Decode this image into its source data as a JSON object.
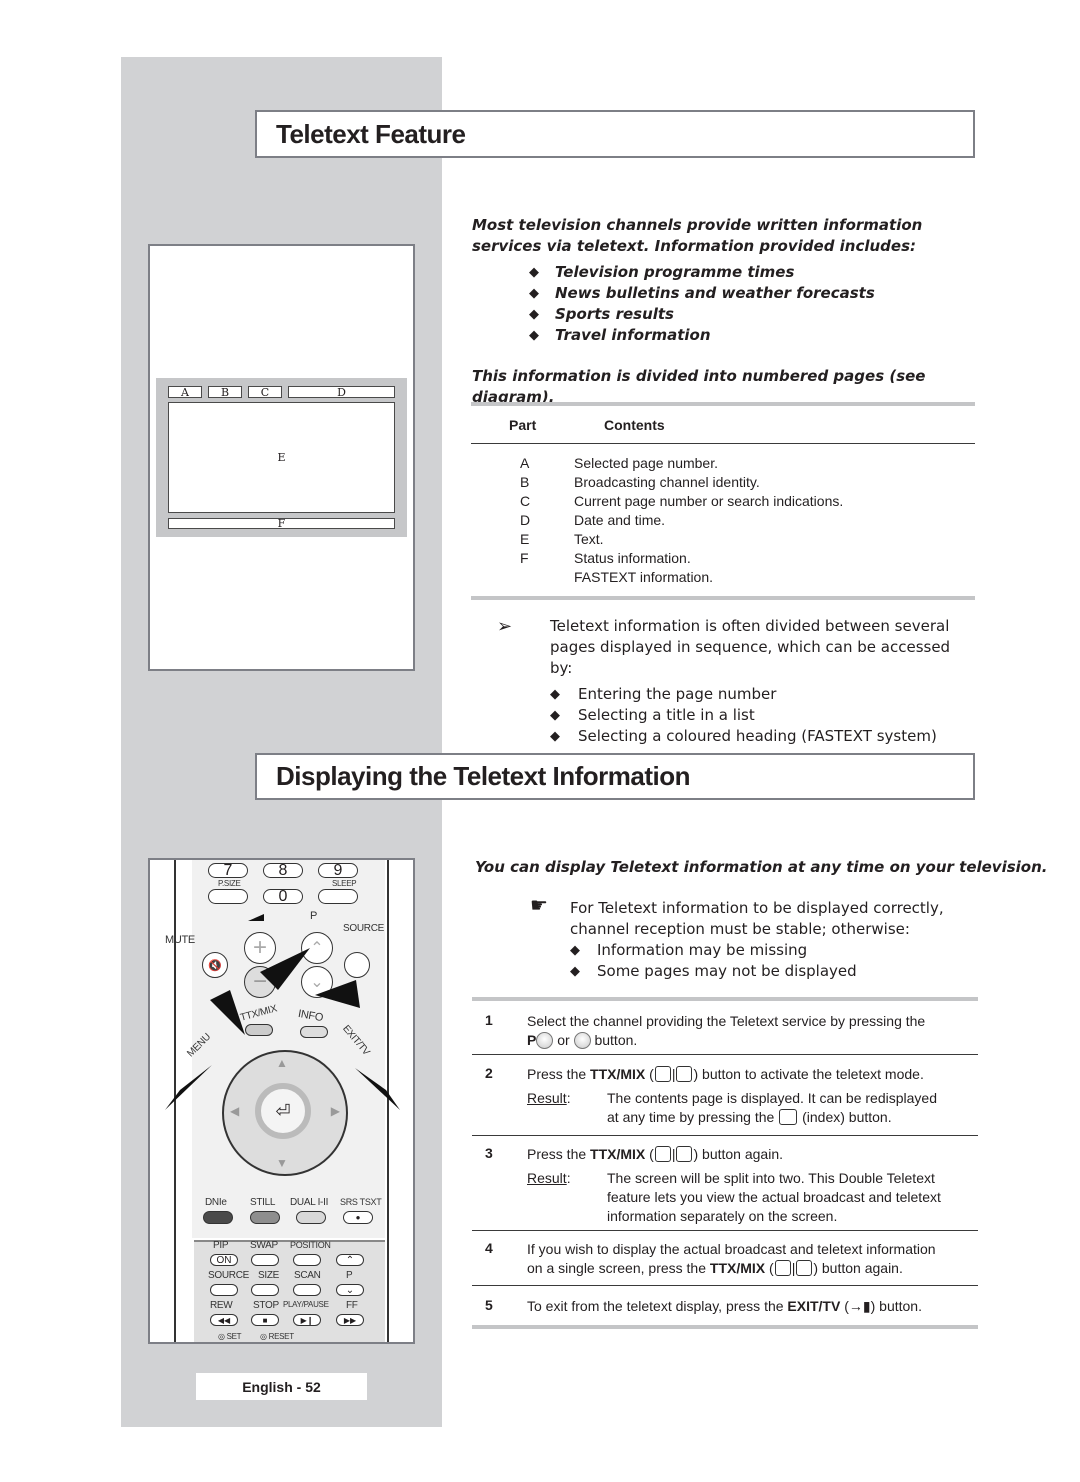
{
  "section1": {
    "title": "Teletext Feature",
    "intro": "Most television channels provide written information services via teletext. Information provided includes:",
    "bullets": [
      "Television programme times",
      "News bulletins and weather forecasts",
      "Sports results",
      "Travel information"
    ],
    "divided_note": "This information is divided into numbered pages (see diagram).",
    "table": {
      "headers": [
        "Part",
        "Contents"
      ],
      "rows": [
        {
          "part": "A",
          "contents": "Selected page number."
        },
        {
          "part": "B",
          "contents": "Broadcasting channel identity."
        },
        {
          "part": "C",
          "contents": "Current page number or search indications."
        },
        {
          "part": "D",
          "contents": "Date and time."
        },
        {
          "part": "E",
          "contents": "Text."
        },
        {
          "part": "F",
          "contents": "Status information."
        },
        {
          "part": "",
          "contents": "FASTEXT information."
        }
      ]
    },
    "note_icon": "arrow-right-icon",
    "note": "Teletext information is often divided between several pages displayed in sequence, which can be accessed by:",
    "note_bullets": [
      "Entering the page number",
      "Selecting a title in a list",
      "Selecting a coloured heading (FASTEXT system)"
    ],
    "diagram_labels": {
      "a": "A",
      "b": "B",
      "c": "C",
      "d": "D",
      "e": "E",
      "f": "F"
    }
  },
  "section2": {
    "title": "Displaying the Teletext Information",
    "intro": "You can display Teletext information at any time on your television.",
    "caution_icon": "pointing-hand-icon",
    "caution": "For Teletext information to be displayed correctly, channel reception must be stable; otherwise:",
    "caution_bullets": [
      "Information may be missing",
      "Some pages may not be displayed"
    ],
    "steps": [
      {
        "num": "1",
        "text_a": "Select the channel providing the Teletext service by pressing the",
        "text_b_p": "P",
        "text_b_or": "or",
        "text_b_end": "button."
      },
      {
        "num": "2",
        "pre": "Press the",
        "key": "TTX/MIX",
        "post": "button to activate the teletext mode.",
        "result_label": "Result",
        "result_a": "The contents page is displayed. It can be redisplayed",
        "result_b_pre": "at any time by pressing the",
        "result_b_post": "(index) button."
      },
      {
        "num": "3",
        "pre": "Press the",
        "key": "TTX/MIX",
        "post": "button again.",
        "result_label": "Result",
        "result_lines": [
          "The screen will be split into two. This Double Teletext",
          "feature lets you view the actual broadcast and teletext",
          "information separately on the screen."
        ]
      },
      {
        "num": "4",
        "line1": "If you wish to display the actual broadcast and teletext information",
        "pre": "on a single screen, press the",
        "key": "TTX/MIX",
        "post": "button again."
      },
      {
        "num": "5",
        "pre": "To exit from the teletext display, press the",
        "key": "EXIT/TV",
        "post": "button."
      }
    ]
  },
  "remote": {
    "digits": [
      "7",
      "8",
      "9",
      "0"
    ],
    "labels": {
      "psize": "P.SIZE",
      "sleep": "SLEEP",
      "p": "P",
      "source": "SOURCE",
      "mute": "MUTE",
      "ttxmix": "TTX/MIX",
      "info": "INFO",
      "menu": "MENU",
      "exittv": "EXIT/TV",
      "dnie": "DNIe",
      "still": "STILL",
      "dual": "DUAL I-II",
      "srs": "SRS TSXT",
      "pip": "PIP",
      "swap": "SWAP",
      "position": "POSITION",
      "on": "ON",
      "source2": "SOURCE",
      "size": "SIZE",
      "scan": "SCAN",
      "p2": "P",
      "rew": "REW",
      "stop": "STOP",
      "playpause": "PLAY/PAUSE",
      "ff": "FF",
      "set": "SET",
      "reset": "RESET"
    },
    "colors": {
      "dnie": "#4a4a4a",
      "still": "#8e8e8e",
      "dual": "#d8d8d8"
    }
  },
  "footer": {
    "page_label": "English - 52"
  }
}
